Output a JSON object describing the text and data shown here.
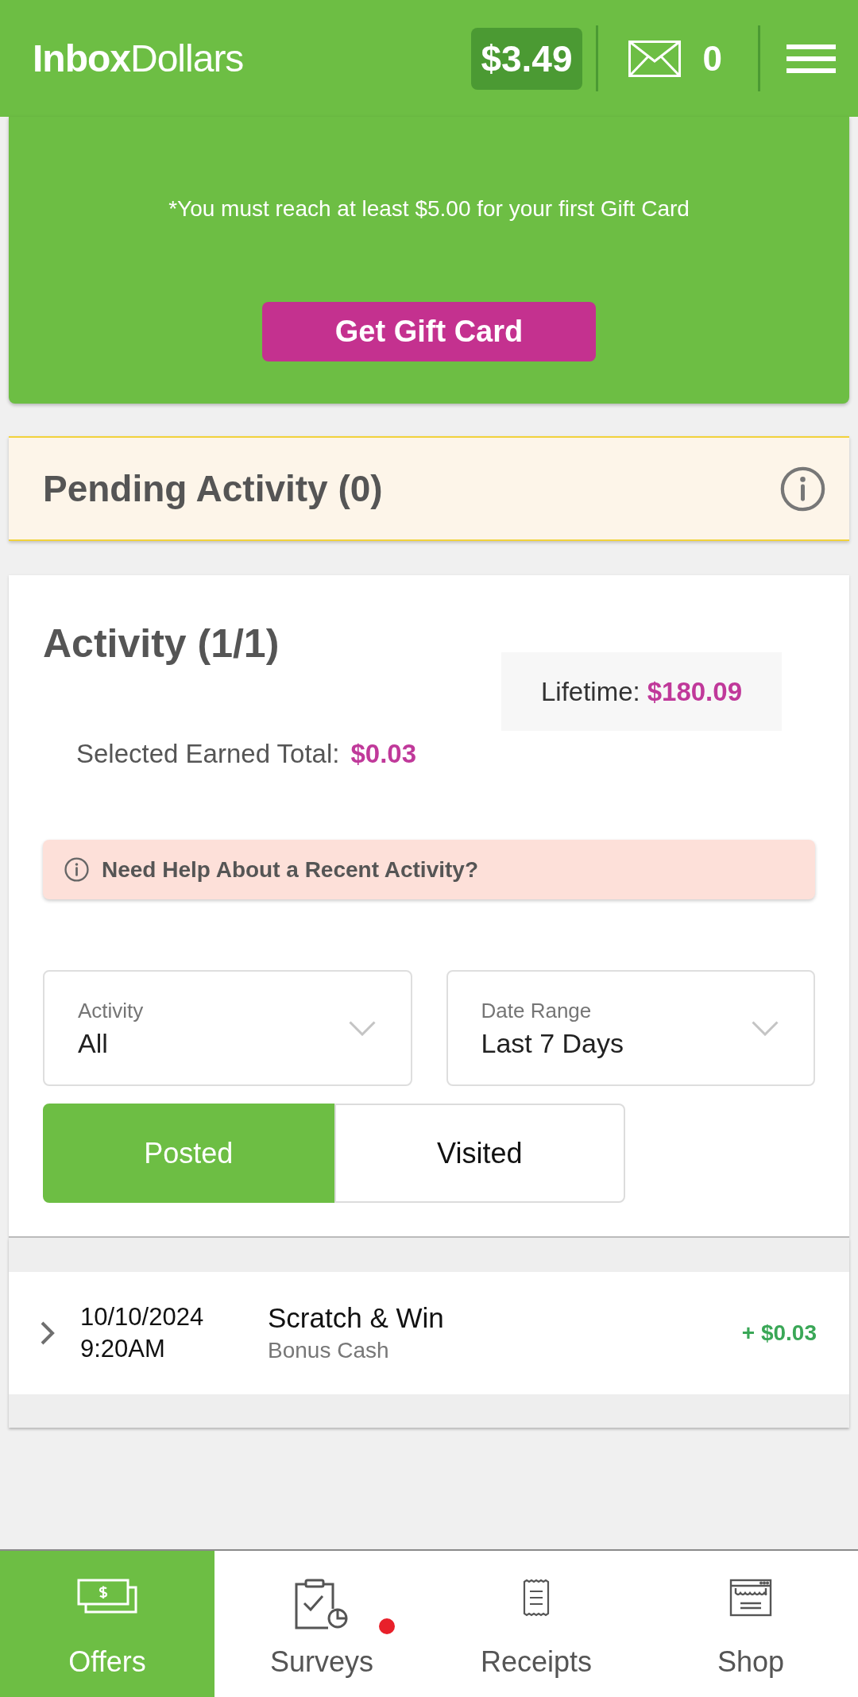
{
  "header": {
    "logo": "**Inbox**Dollars",
    "balance": "$3.49",
    "message_count": "0"
  },
  "gift_card": {
    "notice": "*You must reach at least $5.00 for your first Gift Card",
    "button": "Get Gift Card"
  },
  "pending": {
    "title": "Pending Activity (0)"
  },
  "activity": {
    "title": "Activity (1/1)",
    "lifetime": {
      "label": "Lifetime:",
      "value": "$180.09"
    },
    "selected_total": {
      "label": "Selected Earned Total:",
      "value": "$0.03"
    },
    "help": "Need Help About a Recent Activity?",
    "filters": [
      {
        "label": "Activity",
        "value": "All"
      },
      {
        "label": "Date Range",
        "value": "Last 7 Days"
      }
    ],
    "tabs": [
      {
        "label": "Posted",
        "selected": true
      },
      {
        "label": "Visited",
        "selected": false
      }
    ]
  },
  "entries": [
    {
      "date": "10/10/2024",
      "time": "9:20AM",
      "title": "Scratch & Win",
      "type": "Bonus Cash",
      "amount": "+ $0.03"
    }
  ],
  "bottom_nav": [
    {
      "label": "Offers",
      "selected": true,
      "notification": false
    },
    {
      "label": "Surveys",
      "selected": false,
      "notification": true
    },
    {
      "label": "Receipts",
      "selected": false,
      "notification": false
    },
    {
      "label": "Shop",
      "selected": false,
      "notification": false
    }
  ]
}
